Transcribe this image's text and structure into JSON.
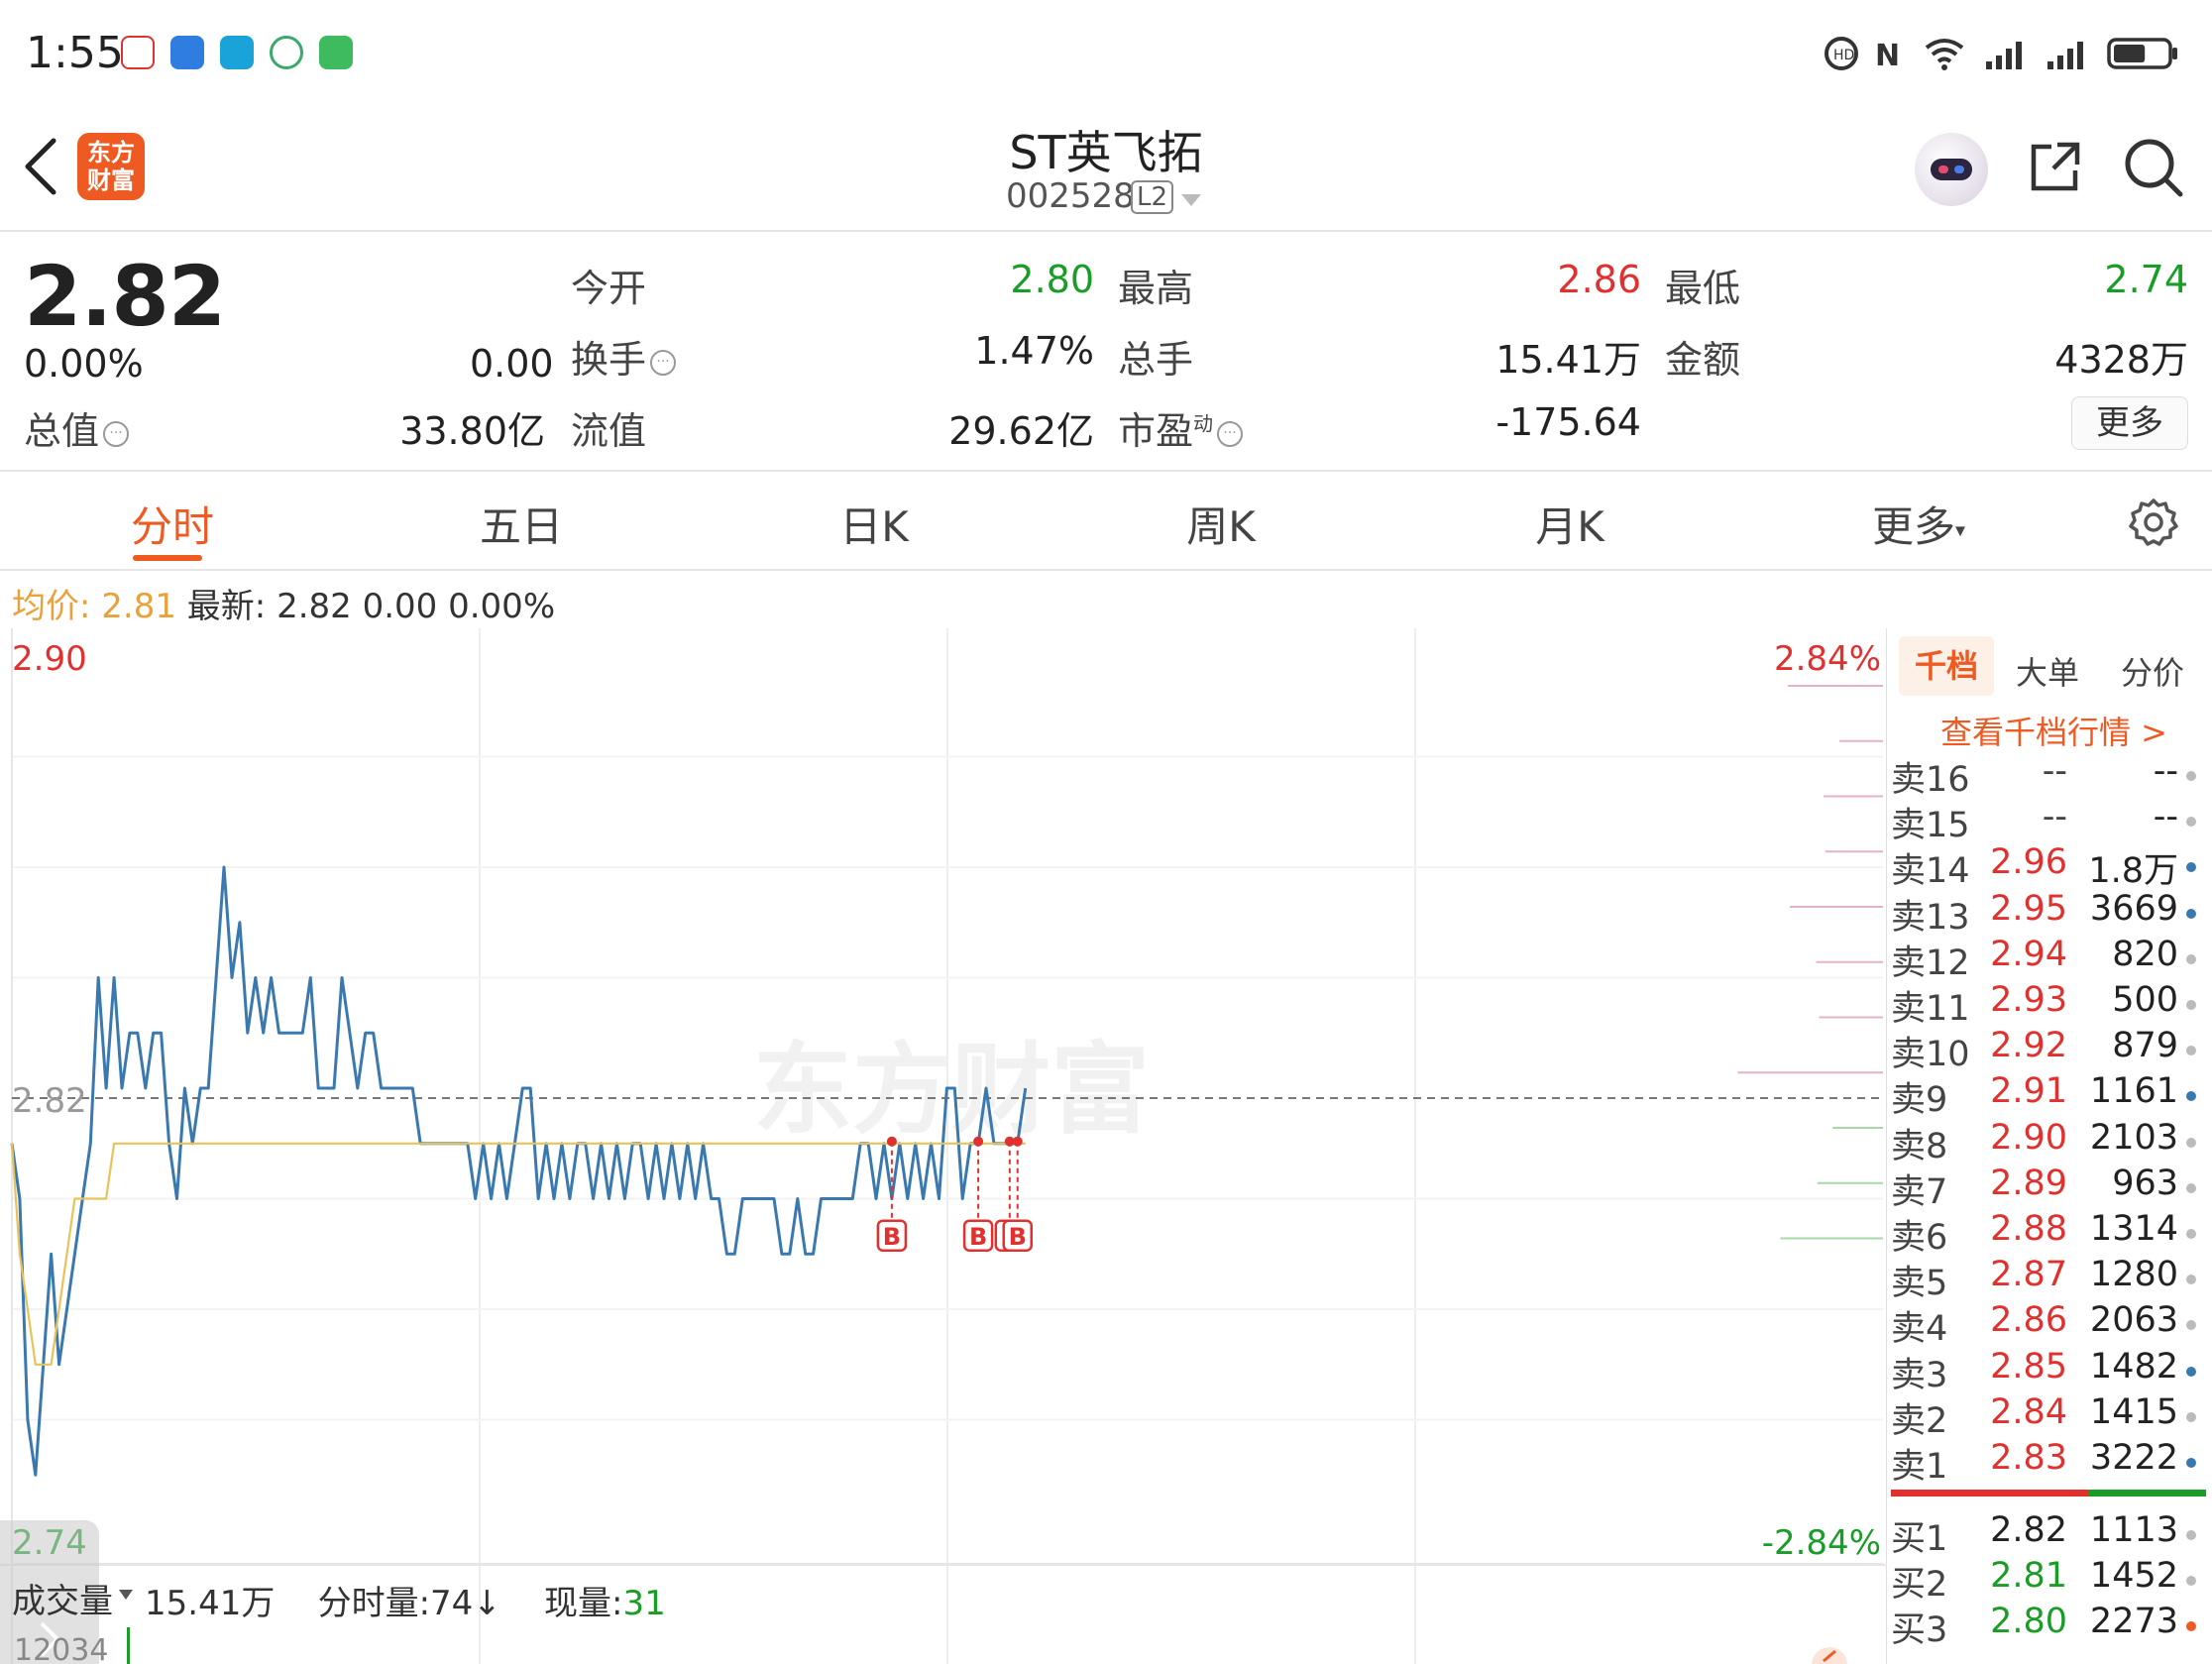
{
  "status_bar": {
    "time": "1:55",
    "battery_level": 0.6
  },
  "header": {
    "title": "ST英飞拓",
    "code": "002528",
    "level_badge": "L2",
    "logo_text": [
      "东方",
      "财富"
    ]
  },
  "quote": {
    "price": "2.82",
    "change_pct": "0.00%",
    "change": "0.00",
    "fields": [
      {
        "label": "今开",
        "value": "2.80",
        "color": "green"
      },
      {
        "label": "最高",
        "value": "2.86",
        "color": "red"
      },
      {
        "label": "最低",
        "value": "2.74",
        "color": "green"
      },
      {
        "label": "换手",
        "value": "1.47%",
        "color": "dark"
      },
      {
        "label": "总手",
        "value": "15.41万",
        "color": "dark"
      },
      {
        "label": "金额",
        "value": "4328万",
        "color": "dark"
      },
      {
        "label": "总值",
        "value": "33.80亿",
        "color": "dark"
      },
      {
        "label": "流值",
        "value": "29.62亿",
        "color": "dark"
      },
      {
        "label": "市盈",
        "value": "-175.64",
        "color": "dark"
      }
    ],
    "pe_superscript": "动",
    "more_label": "更多"
  },
  "tabs": [
    "分时",
    "五日",
    "日K",
    "周K",
    "月K",
    "更多"
  ],
  "info_line": {
    "avg_label": "均价:",
    "avg_value": "2.81",
    "latest_label": "最新:",
    "latest_value": "2.82",
    "latest_change": "0.00",
    "latest_pct": "0.00%"
  },
  "chart_data": {
    "type": "line",
    "y_axis": {
      "max_label": "2.90",
      "mid_label": "2.82",
      "min_label": "2.74",
      "max_pct": "2.84%",
      "min_pct": "-2.84%",
      "range": [
        2.74,
        2.9
      ]
    },
    "watermark": "东方财富",
    "series": [
      {
        "name": "最新",
        "color": "#3a78b0",
        "values": [
          2.81,
          2.8,
          2.76,
          2.75,
          2.77,
          2.79,
          2.77,
          2.78,
          2.79,
          2.8,
          2.81,
          2.84,
          2.82,
          2.84,
          2.82,
          2.83,
          2.83,
          2.82,
          2.83,
          2.83,
          2.81,
          2.8,
          2.82,
          2.81,
          2.82,
          2.82,
          2.84,
          2.86,
          2.84,
          2.85,
          2.83,
          2.84,
          2.83,
          2.84,
          2.83,
          2.83,
          2.83,
          2.83,
          2.84,
          2.82,
          2.82,
          2.82,
          2.84,
          2.83,
          2.82,
          2.83,
          2.83,
          2.82,
          2.82,
          2.82,
          2.82,
          2.82,
          2.81,
          2.81,
          2.81,
          2.81,
          2.81,
          2.81,
          2.81,
          2.8,
          2.81,
          2.8,
          2.81,
          2.8,
          2.81,
          2.82,
          2.82,
          2.8,
          2.81,
          2.8,
          2.81,
          2.8,
          2.81,
          2.81,
          2.8,
          2.81,
          2.8,
          2.81,
          2.8,
          2.81,
          2.81,
          2.8,
          2.81,
          2.8,
          2.81,
          2.8,
          2.81,
          2.8,
          2.81,
          2.8,
          2.8,
          2.79,
          2.79,
          2.8,
          2.8,
          2.8,
          2.8,
          2.8,
          2.79,
          2.79,
          2.8,
          2.79,
          2.79,
          2.8,
          2.8,
          2.8,
          2.8,
          2.8,
          2.81,
          2.81,
          2.8,
          2.81,
          2.8,
          2.81,
          2.8,
          2.81,
          2.8,
          2.81,
          2.8,
          2.82,
          2.82,
          2.8,
          2.81,
          2.81,
          2.82,
          2.81,
          2.81,
          2.81,
          2.81,
          2.82
        ],
        "x_max": 240
      },
      {
        "name": "均价",
        "color": "#e9c25a",
        "values": [
          2.81,
          2.79,
          2.78,
          2.77,
          2.77,
          2.77,
          2.78,
          2.79,
          2.8,
          2.8,
          2.8,
          2.8,
          2.8,
          2.81,
          2.81,
          2.81,
          2.81,
          2.81,
          2.81,
          2.81,
          2.81,
          2.81,
          2.81,
          2.81,
          2.81,
          2.81,
          2.81,
          2.81,
          2.81,
          2.81,
          2.81,
          2.81,
          2.81,
          2.81,
          2.81,
          2.81,
          2.81,
          2.81,
          2.81,
          2.81,
          2.81,
          2.81,
          2.81,
          2.81,
          2.81,
          2.81,
          2.81,
          2.81,
          2.81,
          2.81,
          2.81,
          2.81,
          2.81,
          2.81,
          2.81,
          2.81,
          2.81,
          2.81,
          2.81,
          2.81,
          2.81,
          2.81,
          2.81,
          2.81,
          2.81,
          2.81,
          2.81,
          2.81,
          2.81,
          2.81,
          2.81,
          2.81,
          2.81,
          2.81,
          2.81,
          2.81,
          2.81,
          2.81,
          2.81,
          2.81,
          2.81,
          2.81,
          2.81,
          2.81,
          2.81,
          2.81,
          2.81,
          2.81,
          2.81,
          2.81,
          2.81,
          2.81,
          2.81,
          2.81,
          2.81,
          2.81,
          2.81,
          2.81,
          2.81,
          2.81,
          2.81,
          2.81,
          2.81,
          2.81,
          2.81,
          2.81,
          2.81,
          2.81,
          2.81,
          2.81,
          2.81,
          2.81,
          2.81,
          2.81,
          2.81,
          2.81,
          2.81,
          2.81,
          2.81,
          2.81,
          2.81,
          2.81,
          2.81,
          2.81,
          2.81,
          2.81,
          2.81,
          2.81,
          2.81,
          2.81
        ],
        "x_max": 240
      }
    ],
    "markers": [
      "B",
      "B",
      "B",
      "B"
    ]
  },
  "order_book": {
    "tabs": [
      "千档",
      "大单",
      "分价"
    ],
    "link": "查看千档行情 >",
    "asks": [
      {
        "name": "卖16",
        "price": "--",
        "vol": "--",
        "dot": "gray"
      },
      {
        "name": "卖15",
        "price": "--",
        "vol": "--",
        "dot": "gray"
      },
      {
        "name": "卖14",
        "price": "2.96",
        "vol": "1.8万",
        "dot": "blue"
      },
      {
        "name": "卖13",
        "price": "2.95",
        "vol": "3669",
        "dot": "blue"
      },
      {
        "name": "卖12",
        "price": "2.94",
        "vol": "820",
        "dot": "gray"
      },
      {
        "name": "卖11",
        "price": "2.93",
        "vol": "500",
        "dot": "gray"
      },
      {
        "name": "卖10",
        "price": "2.92",
        "vol": "879",
        "dot": "gray"
      },
      {
        "name": "卖9",
        "price": "2.91",
        "vol": "1161",
        "dot": "blue"
      },
      {
        "name": "卖8",
        "price": "2.90",
        "vol": "2103",
        "dot": "gray"
      },
      {
        "name": "卖7",
        "price": "2.89",
        "vol": "963",
        "dot": "gray"
      },
      {
        "name": "卖6",
        "price": "2.88",
        "vol": "1314",
        "dot": "gray"
      },
      {
        "name": "卖5",
        "price": "2.87",
        "vol": "1280",
        "dot": "gray"
      },
      {
        "name": "卖4",
        "price": "2.86",
        "vol": "2063",
        "dot": "gray"
      },
      {
        "name": "卖3",
        "price": "2.85",
        "vol": "1482",
        "dot": "blue"
      },
      {
        "name": "卖2",
        "price": "2.84",
        "vol": "1415",
        "dot": "gray"
      },
      {
        "name": "卖1",
        "price": "2.83",
        "vol": "3222",
        "dot": "blue"
      }
    ],
    "bids": [
      {
        "name": "买1",
        "price": "2.82",
        "vol": "1113",
        "dot": "gray"
      },
      {
        "name": "买2",
        "price": "2.81",
        "vol": "1452",
        "dot": "gray"
      },
      {
        "name": "买3",
        "price": "2.80",
        "vol": "2273",
        "dot": "orange"
      }
    ]
  },
  "volume": {
    "label": "成交量",
    "total": "15.41万",
    "per_min_label": "分时量:",
    "per_min_value": "74↓",
    "now_label": "现量:",
    "now_value": "31",
    "scale": "12034"
  },
  "colors": {
    "accent": "#ef5a23",
    "up": "#e0312e",
    "down": "#1a9d26",
    "price_line": "#3a78b0",
    "avg_line": "#e9c25a"
  }
}
